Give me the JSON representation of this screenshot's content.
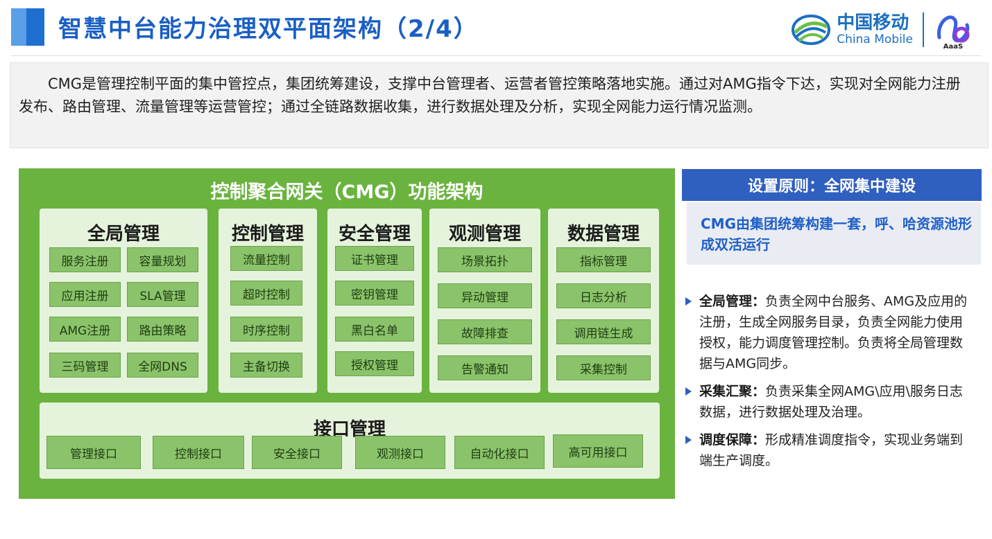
{
  "header": {
    "title": "智慧中台能力治理双平面架构（2/4）",
    "logo_cn": "中国移动",
    "logo_en": "China Mobile",
    "logo_aams": "AaaS"
  },
  "intro": {
    "text": "CMG是管理控制平面的集中管控点，集团统筹建设，支撑中台管理者、运营者管控策略落地实施。通过对AMG指令下达，实现对全网能力注册发布、路由管理、流量管理等运营管控；通过全链路数据收集，进行数据处理及分析，实现全网能力运行情况监测。"
  },
  "cmg": {
    "title": "控制聚合网关（CMG）功能架构",
    "global": {
      "title": "全局管理",
      "items": [
        "服务注册",
        "容量规划",
        "应用注册",
        "SLA管理",
        "AMG注册",
        "路由策略",
        "三码管理",
        "全网DNS"
      ]
    },
    "control": {
      "title": "控制管理",
      "items": [
        "流量控制",
        "超时控制",
        "时序控制",
        "主备切换"
      ]
    },
    "security": {
      "title": "安全管理",
      "items": [
        "证书管理",
        "密钥管理",
        "黑白名单",
        "授权管理"
      ]
    },
    "observe": {
      "title": "观测管理",
      "items": [
        "场景拓扑",
        "异动管理",
        "故障排查",
        "告警通知"
      ]
    },
    "data": {
      "title": "数据管理",
      "items": [
        "指标管理",
        "日志分析",
        "调用链生成",
        "采集控制"
      ]
    },
    "interface": {
      "title": "接口管理",
      "items": [
        "管理接口",
        "控制接口",
        "安全接口",
        "观测接口",
        "自动化接口",
        "高可用接口"
      ]
    }
  },
  "side": {
    "header": "设置原则：全网集中建设",
    "box_text": "CMG由集团统筹构建一套，呼、哈资源池形成双活运行",
    "bullets": [
      {
        "label": "全局管理：",
        "text": "负责全网中台服务、AMG及应用的注册，生成全网服务目录，负责全网能力使用授权，能力调度管理控制。负责将全局管理数据与AMG同步。"
      },
      {
        "label": "采集汇聚：",
        "text": "负责采集全网AMG\\应用\\服务日志数据，进行数据处理及治理。"
      },
      {
        "label": "调度保障：",
        "text": "形成精准调度指令，实现业务端到端生产调度。"
      }
    ]
  },
  "colors": {
    "primary_blue": "#1a5fc4",
    "cmg_green": "#6ab33f",
    "panel_light_green": "#e6f3dc",
    "item_green": "#8bc36a",
    "side_header_blue": "#2f5fbf"
  }
}
